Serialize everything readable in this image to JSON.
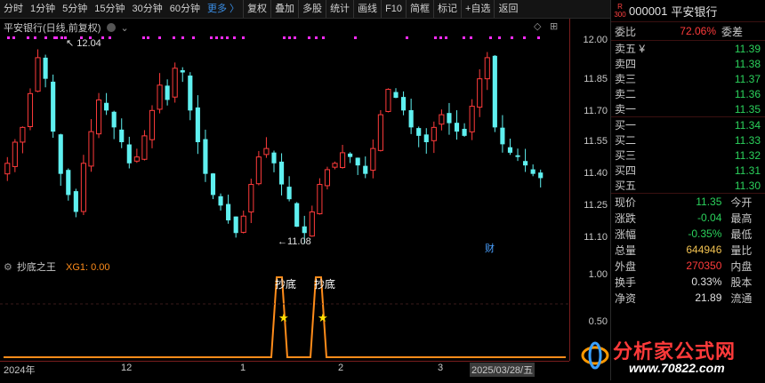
{
  "toolbar": {
    "periods": [
      "分时",
      "1分钟",
      "5分钟",
      "15分钟",
      "30分钟",
      "60分钟"
    ],
    "more": "更多 〉",
    "tools": [
      "复权",
      "叠加",
      "多股",
      "统计",
      "画线",
      "F10",
      "简框",
      "标记",
      "+自选",
      "返回"
    ]
  },
  "main_chart": {
    "title": "平安银行(日线,前复权)",
    "price_ticks": [
      "12.00",
      "11.85",
      "11.70",
      "11.55",
      "11.40",
      "11.25",
      "11.10"
    ],
    "high_label": "12.04",
    "low_label": "11.08",
    "event_marker": "财",
    "colors": {
      "up": "#ff3b3b",
      "down": "#5ff0f0",
      "marker": "#ff2bff"
    }
  },
  "sub_chart": {
    "indicator": "抄底之王",
    "value_text": "XG1: 0.00",
    "ticks": [
      "1.00",
      "0.50"
    ],
    "signal_label": "抄底",
    "colors": {
      "line": "#ff8c1a",
      "star": "#ffe000"
    }
  },
  "time_axis": {
    "labels": [
      "2024年",
      "12",
      "1",
      "2",
      "3",
      "2025/03/28/五"
    ]
  },
  "quote": {
    "badge": "R\n300",
    "code": "000001",
    "name": "平安银行",
    "weibi_label": "委比",
    "weibi_value": "72.06%",
    "weicha_label": "委差",
    "asks": [
      {
        "label": "卖五 ¥",
        "price": "11.39"
      },
      {
        "label": "卖四",
        "price": "11.38"
      },
      {
        "label": "卖三",
        "price": "11.37"
      },
      {
        "label": "卖二",
        "price": "11.36"
      },
      {
        "label": "卖一",
        "price": "11.35"
      }
    ],
    "bids": [
      {
        "label": "买一",
        "price": "11.34"
      },
      {
        "label": "买二",
        "price": "11.33"
      },
      {
        "label": "买三",
        "price": "11.32"
      },
      {
        "label": "买四",
        "price": "11.31"
      },
      {
        "label": "买五",
        "price": "11.30"
      }
    ],
    "stats": [
      {
        "label": "现价",
        "value": "11.35",
        "color": "green",
        "label2": "今开"
      },
      {
        "label": "涨跌",
        "value": "-0.04",
        "color": "green",
        "label2": "最高"
      },
      {
        "label": "涨幅",
        "value": "-0.35%",
        "color": "green",
        "label2": "最低"
      },
      {
        "label": "总量",
        "value": "644946",
        "color": "yellow",
        "label2": "量比"
      },
      {
        "label": "外盘",
        "value": "270350",
        "color": "red",
        "label2": "内盘"
      },
      {
        "label": "换手",
        "value": "0.33%",
        "color": "white",
        "label2": "股本"
      },
      {
        "label": "净资",
        "value": "21.89",
        "color": "white",
        "label2": "流通"
      }
    ]
  },
  "logo": {
    "title": "分析家公式网",
    "url": "www.70822.com"
  }
}
